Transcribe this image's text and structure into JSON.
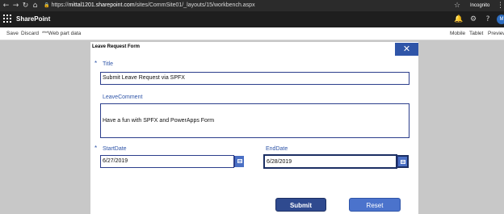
{
  "browser": {
    "url_scheme": "https://",
    "url_host": "mittal1201.sharepoint.com",
    "url_path": "/sites/CommSite01/_layouts/15/workbench.aspx",
    "mode_label": "Incognito"
  },
  "suite_bar": {
    "app_title": "SharePoint",
    "avatar_initial": "M"
  },
  "toolbar": {
    "save_label": "Save",
    "discard_label": "Discard",
    "webpart_label": "***Web part data",
    "mobile_label": "Mobile",
    "tablet_label": "Tablet",
    "preview_label": "Preview"
  },
  "form": {
    "title": "Leave Request Form",
    "close_glyph": "✕",
    "required_marker": "*",
    "title_label": "Title",
    "title_value": "Submit Leave Request via SPFX",
    "comment_label": "LeaveComment",
    "comment_value": "Have a fun with SPFX and PowerApps Form",
    "startdate_label": "StartDate",
    "startdate_value": "6/27/2019",
    "enddate_label": "EndDate",
    "enddate_value": "6/28/2019",
    "submit_label": "Submit",
    "reset_label": "Reset"
  },
  "colors": {
    "accent": "#2f55a8",
    "submit": "#2f4a8f",
    "reset": "#4b73cc",
    "suite_bar": "#1e1e1e",
    "canvas": "#c8c8c8"
  },
  "icons": [
    "back-arrow-icon",
    "forward-arrow-icon",
    "reload-icon",
    "home-icon",
    "lock-icon",
    "star-icon",
    "incognito-icon",
    "more-icon",
    "waffle-icon",
    "bell-icon",
    "gear-icon",
    "help-icon",
    "calendar-icon",
    "close-icon"
  ]
}
